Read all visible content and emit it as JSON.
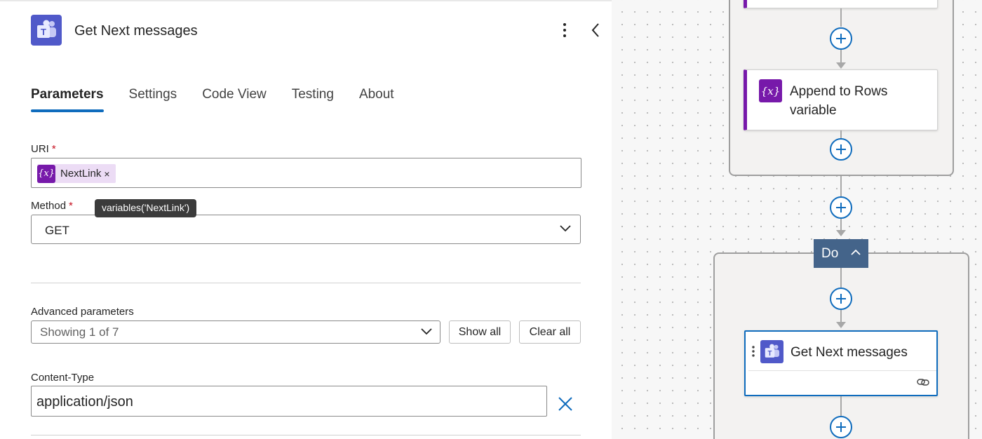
{
  "panel": {
    "title": "Get Next messages",
    "tabs": [
      {
        "label": "Parameters"
      },
      {
        "label": "Settings"
      },
      {
        "label": "Code View"
      },
      {
        "label": "Testing"
      },
      {
        "label": "About"
      }
    ],
    "uri": {
      "label": "URI",
      "required_mark": "*",
      "token_icon_text": "{x}",
      "token_label": "NextLink",
      "token_remove": "×"
    },
    "tooltip": "variables('NextLink')",
    "method": {
      "label": "Method",
      "required_mark": "*",
      "value": "GET"
    },
    "advanced": {
      "label": "Advanced parameters",
      "value": "Showing 1 of 7",
      "show_all": "Show all",
      "clear_all": "Clear all"
    },
    "content_type": {
      "label": "Content-Type",
      "value": "application/json"
    }
  },
  "canvas": {
    "append_card": {
      "icon_text": "{x}",
      "title_line1": "Append to Rows",
      "title_line2": "variable"
    },
    "do_label": "Do",
    "get_next_card": {
      "title": "Get Next messages"
    },
    "colors": {
      "variable": "#7719aa",
      "teams": "#5059c9",
      "accent": "#0f6cbd",
      "do_block": "#44648a"
    }
  }
}
